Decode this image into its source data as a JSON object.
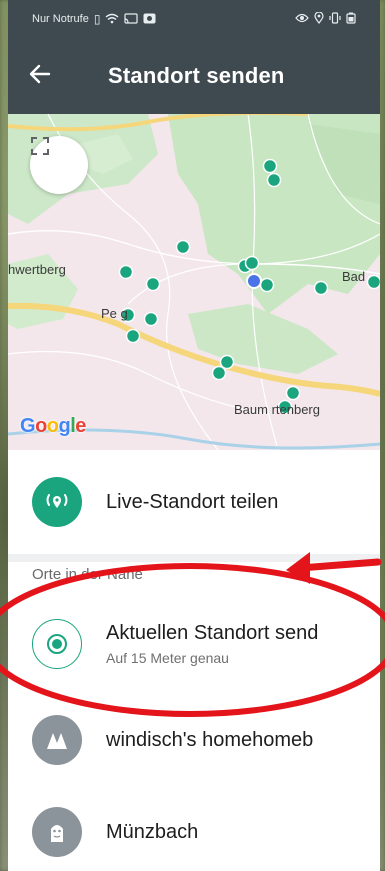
{
  "status_bar": {
    "carrier": "Nur Notrufe",
    "left_icons": [
      "sim-icon",
      "wifi-icon",
      "cast-icon",
      "app-icon"
    ],
    "right_icons": [
      "eye-icon",
      "location-icon",
      "vibrate-icon",
      "battery-icon"
    ]
  },
  "app_bar": {
    "title": "Standort senden",
    "back_icon": "arrow-left-icon"
  },
  "map": {
    "places": [
      "hwertberg",
      "Pe  g",
      "Bad",
      "Baum  rtenberg"
    ],
    "google_logo": "Google",
    "fullscreen_icon": "fullscreen-icon"
  },
  "live_location": {
    "label": "Live-Standort teilen",
    "icon": "live-location-icon",
    "color": "#1aa57e"
  },
  "nearby": {
    "section_label": "Orte in der Nähe",
    "current": {
      "title": "Aktuellen Standort send",
      "subtitle": "Auf 15 Meter genau",
      "icon": "radio-target-icon"
    },
    "places": [
      {
        "name": "windisch's homehomeb",
        "icon": "place-icon"
      },
      {
        "name": "Münzbach",
        "icon": "monument-icon"
      }
    ]
  },
  "colors": {
    "app_bar": "#3e4a4f",
    "accent": "#1aa57e",
    "annotation": "#e4141b"
  }
}
